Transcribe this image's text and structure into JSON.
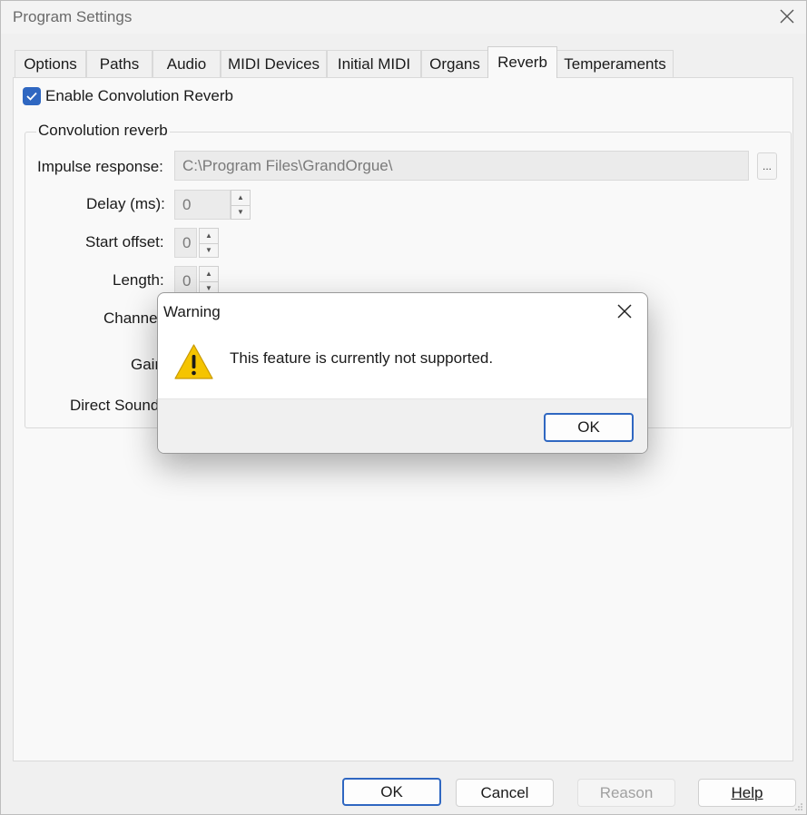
{
  "window": {
    "title": "Program Settings"
  },
  "tabs": [
    {
      "label": "Options"
    },
    {
      "label": "Paths"
    },
    {
      "label": "Audio"
    },
    {
      "label": "MIDI Devices"
    },
    {
      "label": "Initial MIDI"
    },
    {
      "label": "Organs"
    },
    {
      "label": "Reverb"
    },
    {
      "label": "Temperaments"
    }
  ],
  "reverb": {
    "enable_label": "Enable Convolution Reverb",
    "enable_checked": true,
    "group_title": "Convolution reverb",
    "impulse_label": "Impulse response:",
    "impulse_value": "C:\\Program Files\\GrandOrgue\\",
    "browse_label": "...",
    "delay_label": "Delay (ms):",
    "delay_value": "0",
    "start_label": "Start offset:",
    "start_value": "0",
    "length_label": "Length:",
    "length_value": "0",
    "channel_label": "Channe",
    "gain_label": "Gair",
    "direct_label": "Direct Sound"
  },
  "buttons": {
    "ok": "OK",
    "cancel": "Cancel",
    "reason": "Reason",
    "help": "Help"
  },
  "dialog": {
    "title": "Warning",
    "message": "This feature is currently not supported.",
    "ok": "OK",
    "icon": "warning-icon"
  },
  "colors": {
    "accent": "#2f67c1",
    "warning": "#f5c400"
  }
}
